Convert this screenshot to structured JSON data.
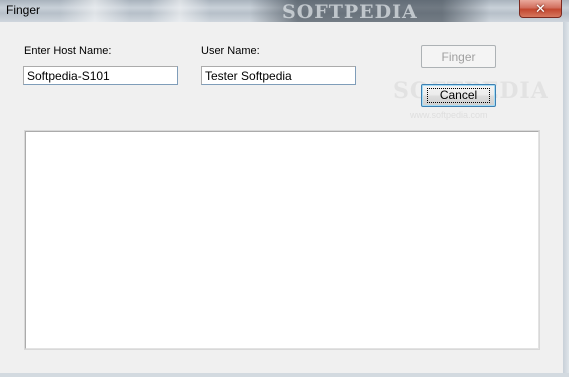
{
  "window": {
    "title": "Finger",
    "title_watermark": "SOFTPEDIA",
    "close_glyph": "✕"
  },
  "form": {
    "host_label": "Enter Host Name:",
    "host_value": "Softpedia-S101",
    "user_label": "User Name:",
    "user_value": "Tester Softpedia"
  },
  "buttons": {
    "finger_label": "Finger",
    "cancel_label": "Cancel"
  },
  "watermark": {
    "text": "SOFTPEDIA",
    "url": "www.softpedia.com"
  },
  "output": {
    "text": ""
  },
  "colors": {
    "close_button": "#c2472f",
    "input_border": "#7f9db9",
    "default_button_border": "#3c7fb1"
  },
  "icons": {
    "close": "close-icon"
  }
}
